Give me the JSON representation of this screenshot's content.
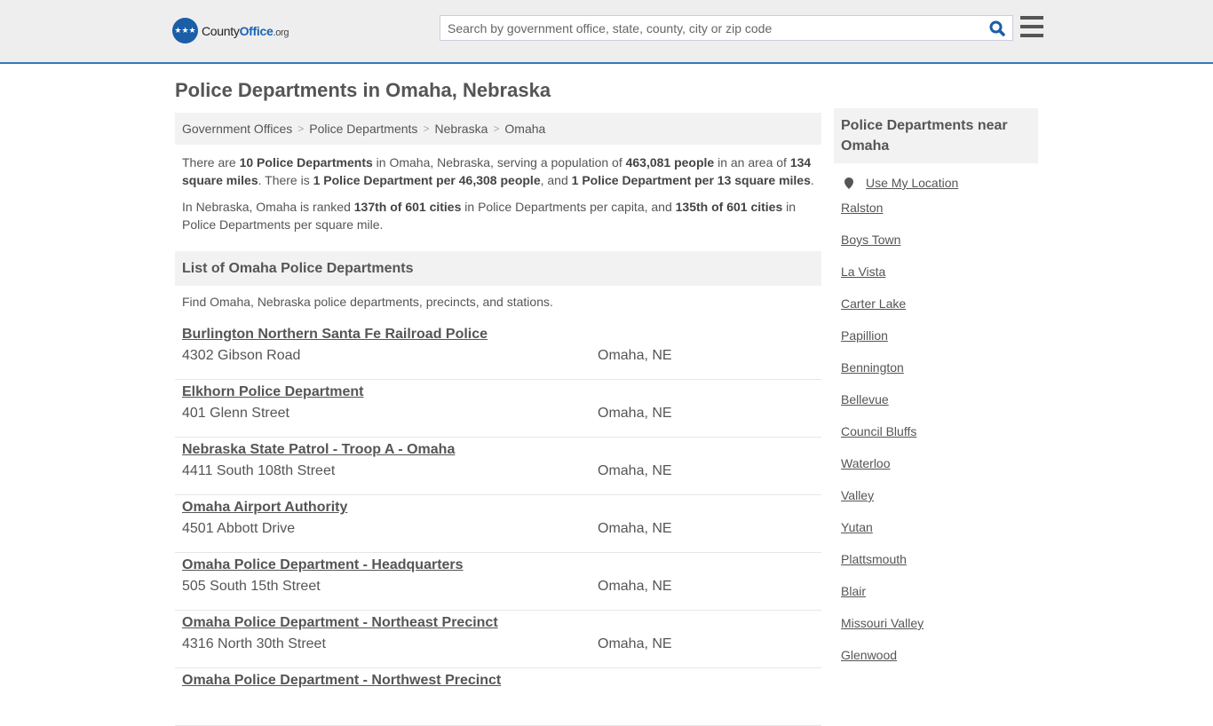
{
  "header": {
    "logo_icon": "eagle-stars-logo",
    "logo_part1": "County",
    "logo_part2": "Office",
    "logo_part3": ".org",
    "search_placeholder": "Search by government office, state, county, city or zip code",
    "search_icon": "search-icon",
    "menu_icon": "hamburger-menu-icon"
  },
  "page": {
    "title": "Police Departments in Omaha, Nebraska"
  },
  "breadcrumb": [
    "Government Offices",
    "Police Departments",
    "Nebraska",
    "Omaha"
  ],
  "summary": {
    "p1": [
      {
        "t": "There are "
      },
      {
        "b": "10 Police Departments"
      },
      {
        "t": " in Omaha, Nebraska, serving a population of "
      },
      {
        "b": "463,081 people"
      },
      {
        "t": " in an area of "
      },
      {
        "b": "134 square miles"
      },
      {
        "t": ". There is "
      },
      {
        "b": "1 Police Department per 46,308 people"
      },
      {
        "t": ", and "
      },
      {
        "b": "1 Police Department per 13 square miles"
      },
      {
        "t": "."
      }
    ],
    "p2": [
      {
        "t": "In Nebraska, Omaha is ranked "
      },
      {
        "b": "137th of 601 cities"
      },
      {
        "t": " in Police Departments per capita, and "
      },
      {
        "b": "135th of 601 cities"
      },
      {
        "t": " in Police Departments per square mile."
      }
    ]
  },
  "list": {
    "heading": "List of Omaha Police Departments",
    "intro": "Find Omaha, Nebraska police departments, precincts, and stations.",
    "items": [
      {
        "name": "Burlington Northern Santa Fe Railroad Police",
        "address": "4302 Gibson Road",
        "city": "Omaha, NE"
      },
      {
        "name": "Elkhorn Police Department",
        "address": "401 Glenn Street",
        "city": "Omaha, NE"
      },
      {
        "name": "Nebraska State Patrol - Troop A - Omaha",
        "address": "4411 South 108th Street",
        "city": "Omaha, NE"
      },
      {
        "name": "Omaha Airport Authority",
        "address": "4501 Abbott Drive",
        "city": "Omaha, NE"
      },
      {
        "name": "Omaha Police Department - Headquarters",
        "address": "505 South 15th Street",
        "city": "Omaha, NE"
      },
      {
        "name": "Omaha Police Department - Northeast Precinct",
        "address": "4316 North 30th Street",
        "city": "Omaha, NE"
      },
      {
        "name": "Omaha Police Department - Northwest Precinct",
        "address": "",
        "city": ""
      }
    ]
  },
  "sidebar": {
    "heading": "Police Departments near Omaha",
    "use_location": "Use My Location",
    "location_icon": "map-pin-icon",
    "cities": [
      "Ralston",
      "Boys Town",
      "La Vista",
      "Carter Lake",
      "Papillion",
      "Bennington",
      "Bellevue",
      "Council Bluffs",
      "Waterloo",
      "Valley",
      "Yutan",
      "Plattsmouth",
      "Blair",
      "Missouri Valley",
      "Glenwood"
    ]
  }
}
